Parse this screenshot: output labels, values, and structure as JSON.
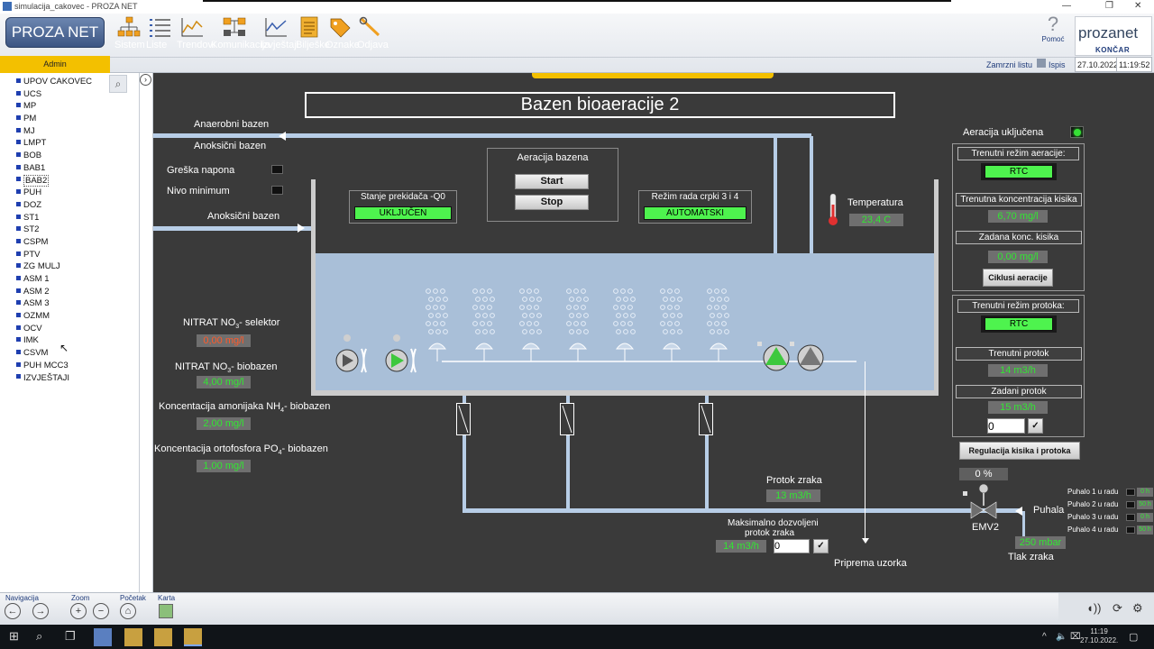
{
  "window": {
    "title": "simulacija_cakovec - PROZA NET",
    "controls": [
      "—",
      "❐",
      "✕"
    ]
  },
  "toolbar": {
    "logo": "PROZA NET",
    "user": "Admin",
    "tools": [
      {
        "label": "Sistem"
      },
      {
        "label": "Liste"
      },
      {
        "label": "Trendovi"
      },
      {
        "label": "Komunikacija"
      },
      {
        "label": "Izvještaji"
      },
      {
        "label": "Bilješke"
      },
      {
        "label": "Oznake"
      },
      {
        "label": "Odjava"
      }
    ],
    "help_label": "Pomoć",
    "freeze_label": "Zamrzni listu",
    "print_label": "Ispis",
    "date": "27.10.2022",
    "time": "11:19:52"
  },
  "brand": {
    "name": "prozanet",
    "company": "KONČAR"
  },
  "sidebar": {
    "items": [
      "UPOV CAKOVEC",
      "UCS",
      "MP",
      "PM",
      "MJ",
      "LMPT",
      "BOB",
      "BAB1",
      "BAB2",
      "PUH",
      "DOZ",
      "ST1",
      "ST2",
      "CSPM",
      "PTV",
      "ZG MULJ",
      "ASM 1",
      "ASM 2",
      "ASM 3",
      "OZMM",
      "OCV",
      "IMK",
      "CSVM",
      "PUH MCC3",
      "IZVJEŠTAJI"
    ],
    "selected": "BAB2"
  },
  "scada": {
    "title": "Bazen bioaeracije 2",
    "anaerobni_bazen": "Anaerobni bazen",
    "anoksicni_bazen_1": "Anoksični bazen",
    "anoksicni_bazen_2": "Anoksični bazen",
    "greska_napona": "Greška napona",
    "nivo_minimum": "Nivo minimum",
    "aeracija_bazena": "Aeracija bazena",
    "start": "Start",
    "stop": "Stop",
    "stanje_prekidaca_label": "Stanje prekidača -Q0",
    "stanje_prekidaca_value": "UKLJUČEN",
    "rezim_crpki_label": "Režim rada crpki 3 i 4",
    "rezim_crpki_value": "AUTOMATSKI",
    "temperatura_label": "Temperatura",
    "temperatura_value": "23,4 C",
    "nitrat_selektor_label": "NITRAT NO",
    "nitrat_selektor_suffix": "- selektor",
    "nitrat_selektor_value": "0,00 mg/l",
    "nitrat_biobazen_label": "NITRAT NO",
    "nitrat_biobazen_suffix": "- biobazen",
    "nitrat_biobazen_value": "4,00 mg/l",
    "amonijak_label": "Koncentacija amonijaka NH",
    "amonijak_suffix": "- biobazen",
    "amonijak_value": "2,00 mg/l",
    "ortofosfor_label": "Koncentacija ortofosfora PO",
    "ortofosfor_suffix": "- biobazen",
    "ortofosfor_value": "1,00 mg/l",
    "sub_3": "3",
    "sub_4": "4",
    "protok_zraka_label": "Protok zraka",
    "protok_zraka_value": "13 m3/h",
    "max_protok_label_1": "Maksimalno dozvoljeni",
    "max_protok_label_2": "protok zraka",
    "max_protok_value": "14 m3/h",
    "max_protok_input": "0",
    "priprema_uzorka": "Priprema uzorka",
    "emv2": "EMV2",
    "puhala": "Puhala",
    "tlak_zraka_label": "Tlak zraka",
    "tlak_zraka_value": "250 mbar",
    "valve_percent": "0 %",
    "check": "✓"
  },
  "right_panel": {
    "aeracija_ukljucena": "Aeracija uključena",
    "trenutni_rezim_aeracije": "Trenutni režim aeracije:",
    "rezim_aeracije_value": "RTC",
    "trenutna_konc_label": "Trenutna koncentracija kisika",
    "trenutna_konc_value": "6,70 mg/l",
    "zadana_konc_label": "Zadana konc. kisika",
    "zadana_konc_value": "0,00 mg/l",
    "ciklusi_aeracije": "Ciklusi aeracije",
    "trenutni_rezim_protoka": "Trenutni režim protoka:",
    "rezim_protoka_value": "RTC",
    "trenutni_protok_label": "Trenutni protok",
    "trenutni_protok_value": "14 m3/h",
    "zadani_protok_label": "Zadani protok",
    "zadani_protok_value": "15 m3/h",
    "zadani_protok_input": "0",
    "regulacija": "Regulacija kisika i protoka",
    "puhala_rows": [
      {
        "label": "Puhalo 1 u radu",
        "value": "0 h"
      },
      {
        "label": "Puhalo 2 u radu",
        "value": "50 h"
      },
      {
        "label": "Puhalo 3 u radu",
        "value": "0 h"
      },
      {
        "label": "Puhalo 4 u radu",
        "value": "50 h"
      }
    ]
  },
  "bottombar": {
    "navigacija": "Navigacija",
    "zoom": "Zoom",
    "pocetak": "Početak",
    "karta": "Karta"
  },
  "taskbar": {
    "time": "11:19",
    "date": "27.10.2022."
  },
  "colors": {
    "canvas_bg": "#3a3a3a",
    "value_green": "#32e632",
    "value_red": "#ff5a2a",
    "status_green": "#4ef34e",
    "user_bar": "#f3c000",
    "water": "#a9bfd8",
    "pipe": "#b7cde6"
  }
}
